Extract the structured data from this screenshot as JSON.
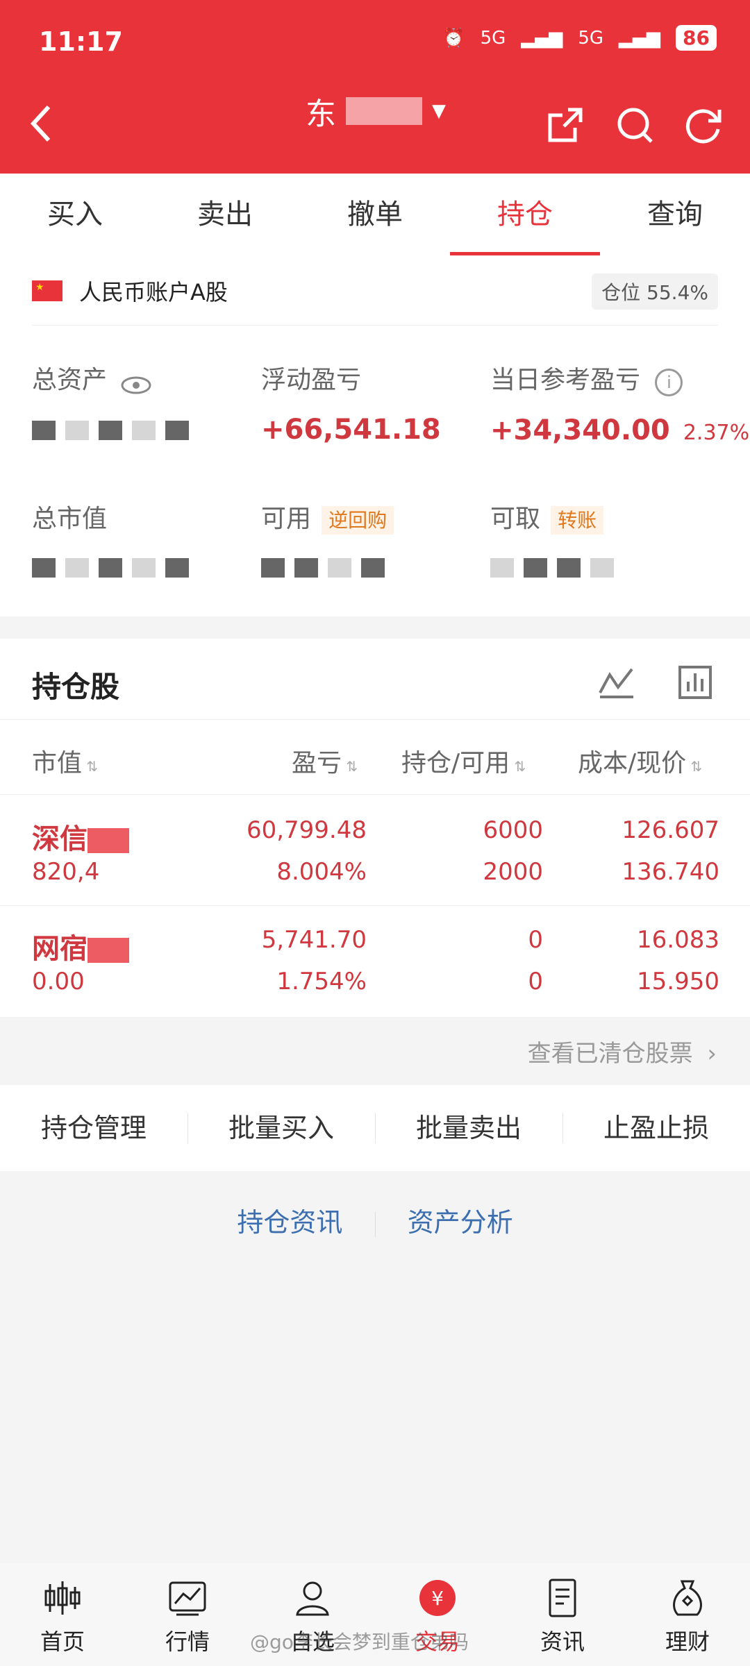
{
  "status_bar": {
    "time": "11:17",
    "network1": "5G",
    "network2": "5G",
    "battery": "86"
  },
  "nav": {
    "title": "东"
  },
  "tabs": [
    {
      "label": "买入"
    },
    {
      "label": "卖出"
    },
    {
      "label": "撤单"
    },
    {
      "label": "持仓"
    },
    {
      "label": "查询"
    }
  ],
  "account": {
    "name": "人民币账户A股",
    "position_label": "仓位",
    "position_value": "55.4%",
    "total_assets_label": "总资产",
    "floating_pl_label": "浮动盈亏",
    "floating_pl_value": "+66,541.18",
    "daily_pl_label": "当日参考盈亏",
    "daily_pl_value": "+34,340.00",
    "daily_pl_pct": "2.37%",
    "market_value_label": "总市值",
    "available_label": "可用",
    "reverse_repo_tag": "逆回购",
    "withdrawable_label": "可取",
    "transfer_tag": "转账"
  },
  "holdings": {
    "title": "持仓股",
    "columns": {
      "market_value": "市值",
      "pl": "盈亏",
      "position": "持仓/可用",
      "cost": "成本/现价"
    },
    "rows": [
      {
        "name": "深信",
        "market_value": "820,4",
        "pl": "60,799.48",
        "pl_pct": "8.004%",
        "position": "6000",
        "available": "2000",
        "cost": "126.607",
        "price": "136.740"
      },
      {
        "name": "网宿",
        "market_value": "0.00",
        "pl": "5,741.70",
        "pl_pct": "1.754%",
        "position": "0",
        "available": "0",
        "cost": "16.083",
        "price": "15.950"
      }
    ]
  },
  "cleared_link": "查看已清仓股票",
  "actions": [
    {
      "label": "持仓管理"
    },
    {
      "label": "批量买入"
    },
    {
      "label": "批量卖出"
    },
    {
      "label": "止盈止损"
    }
  ],
  "links": {
    "news": "持仓资讯",
    "analysis": "资产分析"
  },
  "bottom_nav": [
    {
      "label": "首页",
      "icon": "candlestick-icon"
    },
    {
      "label": "行情",
      "icon": "market-chart-icon"
    },
    {
      "label": "自选",
      "icon": "user-star-icon"
    },
    {
      "label": "交易",
      "icon": "yuan-icon"
    },
    {
      "label": "资讯",
      "icon": "document-icon"
    },
    {
      "label": "理财",
      "icon": "money-bag-icon"
    }
  ],
  "watermark": "@go李长会梦到重仓弟吗",
  "colors": {
    "brand_red": "#e8333b",
    "profit_red": "#d0383f",
    "link_blue": "#3d6fb0",
    "tag_orange": "#e0781d"
  }
}
